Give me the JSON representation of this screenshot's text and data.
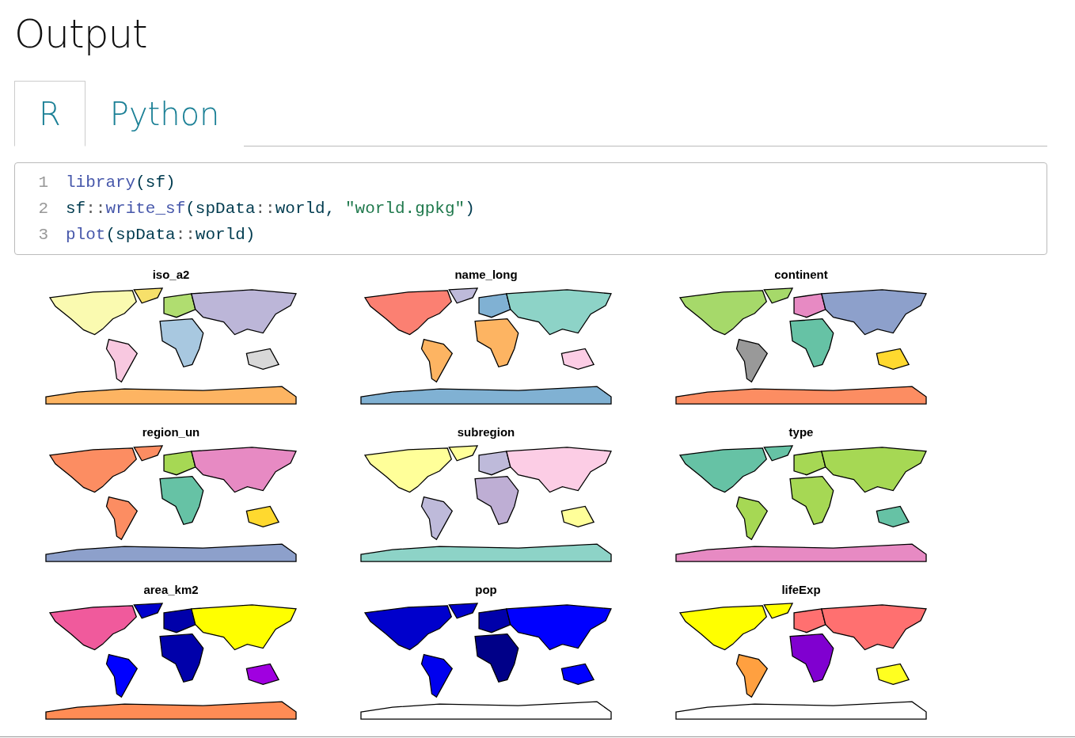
{
  "heading": "Output",
  "tabs": [
    {
      "label": "R",
      "selected": true
    },
    {
      "label": "Python",
      "selected": false
    }
  ],
  "code": {
    "lines": [
      {
        "number": "1",
        "tokens": [
          {
            "kind": "function",
            "text": "library"
          },
          {
            "kind": "plain",
            "text": "(sf)"
          }
        ]
      },
      {
        "number": "2",
        "tokens": [
          {
            "kind": "plain",
            "text": "sf"
          },
          {
            "kind": "operator",
            "text": "::"
          },
          {
            "kind": "function",
            "text": "write_sf"
          },
          {
            "kind": "plain",
            "text": "(spData"
          },
          {
            "kind": "operator",
            "text": "::"
          },
          {
            "kind": "plain",
            "text": "world, "
          },
          {
            "kind": "string",
            "text": "\"world.gpkg\""
          },
          {
            "kind": "plain",
            "text": ")"
          }
        ]
      },
      {
        "number": "3",
        "tokens": [
          {
            "kind": "function",
            "text": "plot"
          },
          {
            "kind": "plain",
            "text": "(spData"
          },
          {
            "kind": "operator",
            "text": "::"
          },
          {
            "kind": "plain",
            "text": "world)"
          }
        ]
      }
    ]
  },
  "maps": [
    {
      "title": "iso_a2"
    },
    {
      "title": "name_long"
    },
    {
      "title": "continent"
    },
    {
      "title": "region_un"
    },
    {
      "title": "subregion"
    },
    {
      "title": "type"
    },
    {
      "title": "area_km2"
    },
    {
      "title": "pop"
    },
    {
      "title": "lifeExp"
    }
  ]
}
